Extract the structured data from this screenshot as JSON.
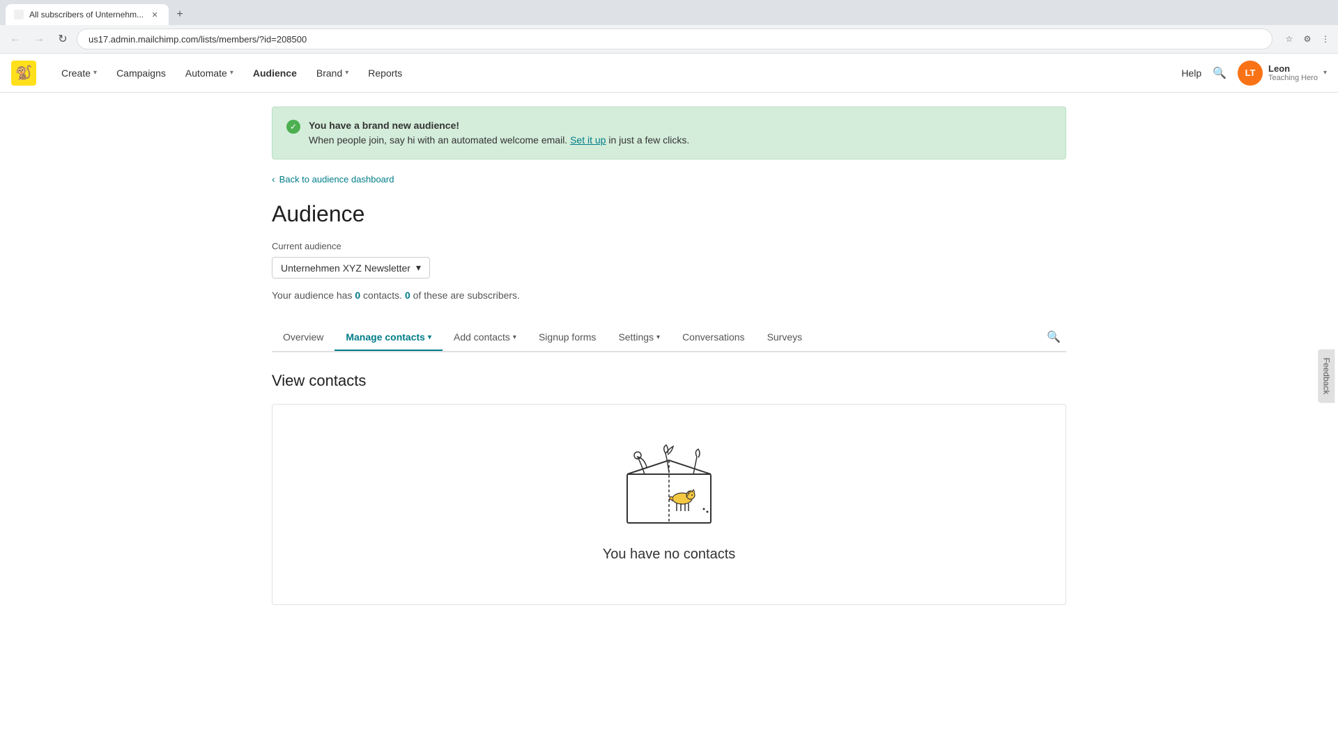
{
  "browser": {
    "tab_title": "All subscribers of Unternehm...",
    "url": "us17.admin.mailchimp.com/lists/members/?id=208500",
    "new_tab_label": "+"
  },
  "nav": {
    "logo_emoji": "🐒",
    "items": [
      {
        "label": "Create",
        "has_chevron": true,
        "active": false
      },
      {
        "label": "Campaigns",
        "has_chevron": false,
        "active": false
      },
      {
        "label": "Automate",
        "has_chevron": true,
        "active": false
      },
      {
        "label": "Audience",
        "has_chevron": false,
        "active": true
      },
      {
        "label": "Brand",
        "has_chevron": true,
        "active": false
      },
      {
        "label": "Reports",
        "has_chevron": false,
        "active": false
      }
    ],
    "help_label": "Help",
    "user": {
      "initials": "LT",
      "name": "Leon",
      "role": "Teaching Hero"
    }
  },
  "banner": {
    "title": "You have a brand new audience!",
    "text": "When people join, say hi with an automated welcome email.",
    "link_text": "Set it up",
    "link_suffix": " in just a few clicks."
  },
  "back_link": "Back to audience dashboard",
  "page_title": "Audience",
  "current_audience_label": "Current audience",
  "audience_select_value": "Unternehmen XYZ Newsletter",
  "stats_text_prefix": "Your audience has ",
  "stats_count1": "0",
  "stats_text_middle": " contacts. ",
  "stats_count2": "0",
  "stats_text_suffix": " of these are subscribers.",
  "sub_nav": {
    "items": [
      {
        "label": "Overview",
        "has_chevron": false,
        "active": false
      },
      {
        "label": "Manage contacts",
        "has_chevron": true,
        "active": true
      },
      {
        "label": "Add contacts",
        "has_chevron": true,
        "active": false
      },
      {
        "label": "Signup forms",
        "has_chevron": false,
        "active": false
      },
      {
        "label": "Settings",
        "has_chevron": true,
        "active": false
      },
      {
        "label": "Conversations",
        "has_chevron": false,
        "active": false
      },
      {
        "label": "Surveys",
        "has_chevron": false,
        "active": false
      }
    ]
  },
  "section_title": "View contacts",
  "empty_state": {
    "title": "You have no contacts"
  },
  "feedback_label": "Feedback"
}
